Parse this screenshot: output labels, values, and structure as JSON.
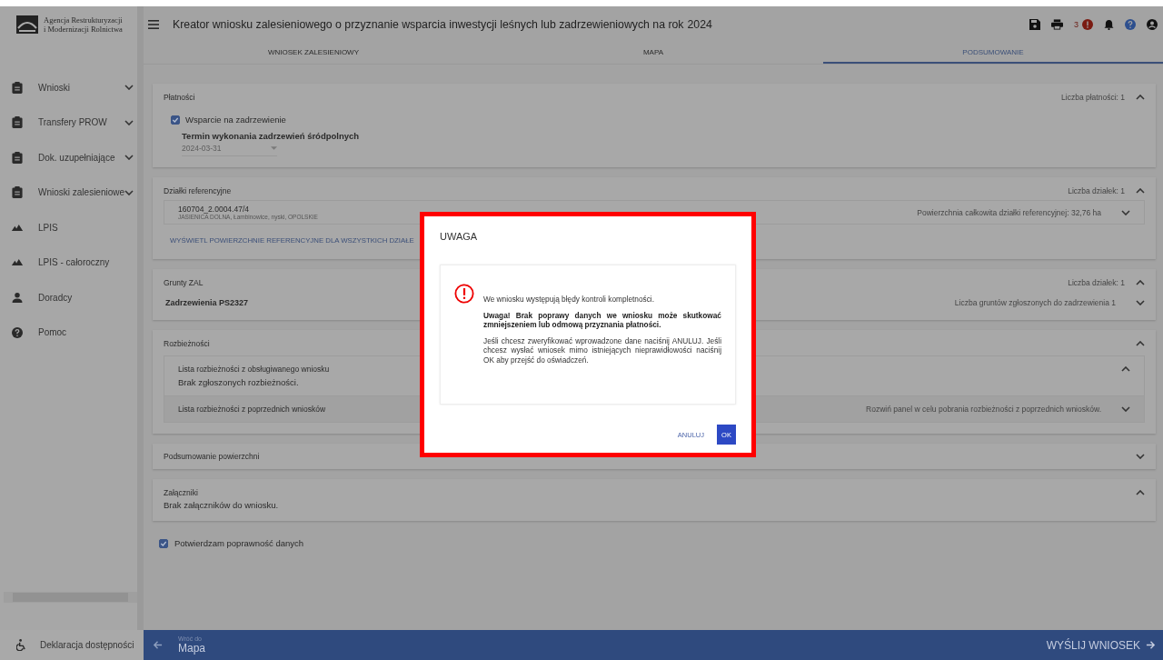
{
  "header": {
    "logo_lines": [
      "Agencja Restrukturyzacji",
      "i Modernizacji Rolnictwa"
    ],
    "title": "Kreator wniosku zalesieniowego o przyznanie wsparcia inwestycji leśnych lub zadrzewieniowych na rok",
    "year": "2024",
    "error_count": "3"
  },
  "tabs": [
    {
      "label": "WNIOSEK ZALESIENIOWY",
      "selected": false
    },
    {
      "label": "MAPA",
      "selected": false
    },
    {
      "label": "PODSUMOWANIE",
      "selected": true
    }
  ],
  "sidebar": {
    "items": [
      {
        "label": "Wnioski",
        "expandable": true
      },
      {
        "label": "Transfery PROW",
        "expandable": true
      },
      {
        "label": "Dok. uzupełniające",
        "expandable": true
      },
      {
        "label": "Wnioski zalesieniowe",
        "expandable": true
      },
      {
        "label": "LPIS",
        "expandable": false
      },
      {
        "label": "LPIS - całoroczny",
        "expandable": false
      },
      {
        "label": "Doradcy",
        "expandable": false
      },
      {
        "label": "Pomoc",
        "expandable": false
      }
    ],
    "footer": "Deklaracja dostępności"
  },
  "sections": [
    {
      "kind": "payments",
      "title": "Płatności",
      "count": "Liczba płatności: 1",
      "expanded": true,
      "checkbox": {
        "label": "Wsparcie na zadrzewienie",
        "checked": true
      },
      "field": {
        "label": "Termin wykonania zadrzewień śródpolnych",
        "value": "2024-03-31"
      }
    },
    {
      "kind": "parcels",
      "title": "Działki referencyjne",
      "count": "Liczba działek: 1",
      "expanded": true,
      "parcel": {
        "id": "160704_2.0004.47/4",
        "address": "JASIENICA DOLNA, Łambinowice, nyski, OPOLSKIE",
        "area": "Powierzchnia całkowita działki referencyjnej: 32,76 ha",
        "expanded": false
      },
      "link": "WYŚWIETL POWIERZCHNIE REFERENCYJNE DLA WSZYSTKICH DZIAŁE"
    },
    {
      "kind": "grounds",
      "title": "Grunty ZAL",
      "count": "Liczba działek: 1",
      "expanded": true,
      "row": {
        "name": "Zadrzewienia PS2327",
        "info": "Liczba gruntów zgłoszonych do zadrzewienia 1",
        "expanded": false
      }
    },
    {
      "kind": "discrepancies",
      "title": "Rozbieżności",
      "expanded": true,
      "panels": [
        {
          "title": "Lista rozbieżności z obsługiwanego wniosku",
          "body": "Brak zgłoszonych rozbieżności.",
          "expanded": true
        },
        {
          "title": "Lista rozbieżności z poprzednich wniosków",
          "info": "Rozwiń panel w celu pobrania rozbieżności z poprzednich wniosków.",
          "expanded": false
        }
      ]
    },
    {
      "kind": "summary",
      "title": "Podsumowanie powierzchni",
      "expanded": false
    },
    {
      "kind": "attachments",
      "title": "Załączniki",
      "body": "Brak załączników do wniosku.",
      "expanded": true
    }
  ],
  "confirm": {
    "label": "Potwierdzam poprawność danych",
    "checked": true
  },
  "bottom_bar": {
    "back_label": "Wróć do",
    "back_target": "Mapa",
    "submit": "WYŚLIJ WNIOSEK"
  },
  "modal": {
    "title": "UWAGA",
    "messages": [
      {
        "kind": "plain",
        "text": "We wniosku występują błędy kontroli kompletności."
      },
      {
        "kind": "bold",
        "text": "Uwaga! Brak poprawy danych we wniosku może skutkować zmniejszeniem lub odmową przyznania płatności."
      },
      {
        "kind": "plain",
        "text": "Jeśli chcesz zweryfikować wprowadzone dane naciśnij ANULUJ. Jeśli chcesz wysłać wniosek mimo istniejących nieprawidłowości naciśnij OK aby przejść do oświadczeń."
      }
    ],
    "cancel": "ANULUJ",
    "ok": "OK"
  }
}
